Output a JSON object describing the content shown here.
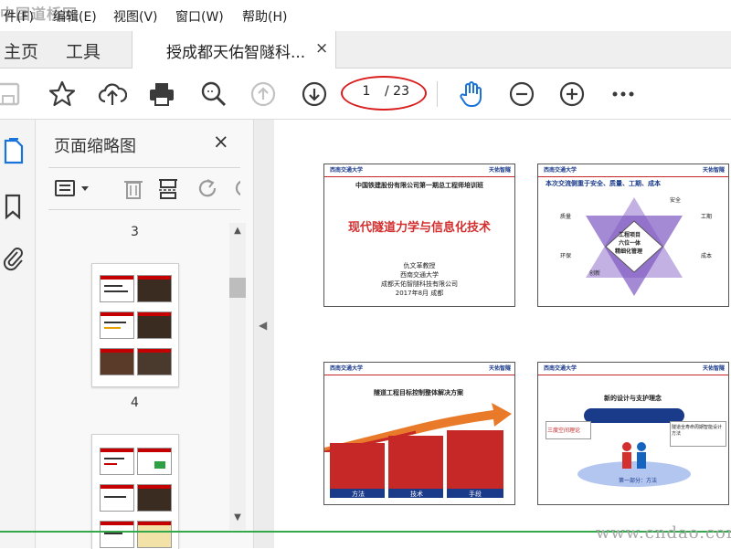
{
  "watermark_top": "中国道桥网",
  "watermark_bottom": "www.cndao.com",
  "menu": {
    "items": [
      "件(F)",
      "编辑(E)",
      "视图(V)",
      "窗口(W)",
      "帮助(H)"
    ]
  },
  "tabs": {
    "home": "主页",
    "tools": "工具",
    "document": "授成都天佑智隧科...",
    "close": "×"
  },
  "toolbar": {
    "page_current": "1",
    "page_total": "/ 23",
    "icons": [
      "save-icon",
      "star-icon",
      "cloud-upload-icon",
      "print-icon",
      "zoom-search-icon",
      "prev-page-icon",
      "next-page-icon",
      "hand-icon",
      "zoom-out-icon",
      "zoom-in-icon",
      "more-icon"
    ]
  },
  "panel": {
    "title": "页面缩略图",
    "close": "×",
    "page_labels": [
      "3",
      "4"
    ]
  },
  "slides": {
    "slide1": {
      "logo_left": "西南交通大学",
      "logo_right": "天佑智隧",
      "subtitle": "中国铁建股份有限公司第一期总工程师培训班",
      "title": "现代隧道力学与信息化技术",
      "author": "仇文革教授",
      "org1": "西南交通大学",
      "org2": "成都天佑智隧科技有限公司",
      "date": "2017年8月  成都"
    },
    "slide2": {
      "heading": "本次交流侧重于安全、质量、工期、成本",
      "center1": "工程项目",
      "center2": "六位一体",
      "center3": "精细化管理",
      "labels": [
        "安全",
        "质量",
        "工期",
        "环保",
        "成本",
        "创新"
      ]
    },
    "slide3": {
      "heading": "隧道工程目标控制整体解决方案",
      "col_labels": [
        "方法",
        "技术",
        "手段"
      ]
    },
    "slide4": {
      "heading": "新的设计与支护理念",
      "left": "三度空间理论",
      "right": "隧道全寿命周期智能设计方法",
      "bottom": "第一部分：方法"
    }
  }
}
